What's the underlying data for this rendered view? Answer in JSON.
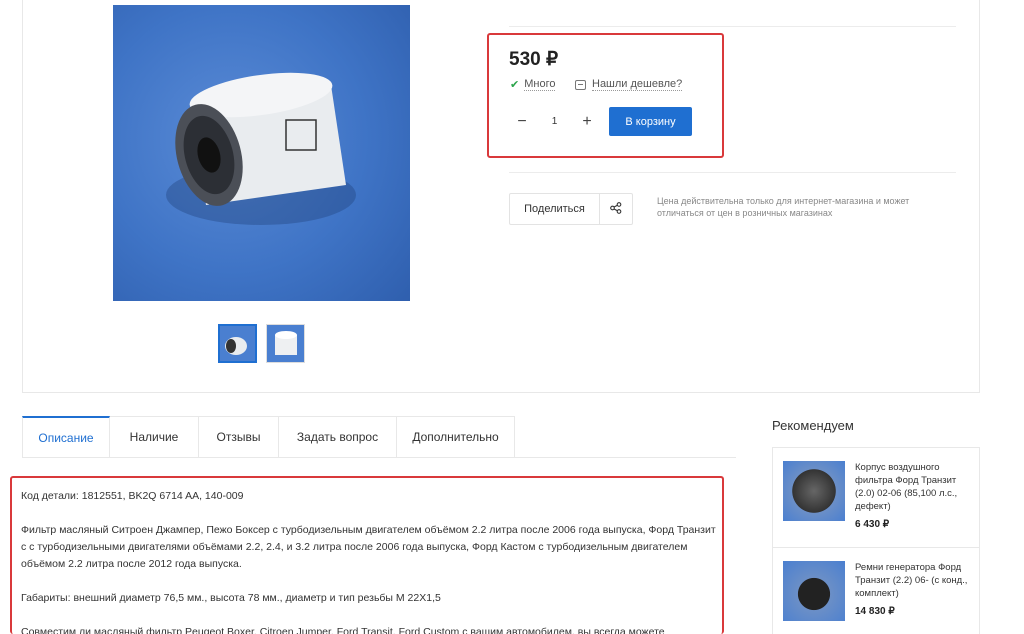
{
  "product": {
    "price": "530 ₽",
    "stock_label": "Много",
    "cheaper_label": "Нашли дешевле?",
    "quantity": "1",
    "cart_button": "В корзину",
    "share_label": "Поделиться",
    "price_note": "Цена действительна только для интернет-магазина и может отличаться от цен в розничных магазинах"
  },
  "tabs": [
    {
      "label": "Описание"
    },
    {
      "label": "Наличие"
    },
    {
      "label": "Отзывы"
    },
    {
      "label": "Задать вопрос"
    },
    {
      "label": "Дополнительно"
    }
  ],
  "description": {
    "p1": "Код детали: 1812551, BK2Q 6714 AA, 140-009",
    "p2": "Фильтр масляный Ситроен Джампер, Пежо Боксер с турбодизельным двигателем объёмом 2.2 литра после 2006 года выпуска, Форд Транзит с с турбодизельными двигателями объёмами 2.2, 2.4, и 3.2 литра после 2006 года выпуска, Форд Кастом с турбодизельным двигателем объёмом 2.2 литра после 2012 года выпуска.",
    "p3": "Габариты: внешний диаметр 76,5 мм., высота 78 мм., диаметр и тип резьбы M 22X1,5",
    "p4": "Совместим ли масляный фильтр Peugeot Boxer, Citroen Jumper, Ford Transit, Ford Custom с вашим автомобилем, вы всегда можете"
  },
  "recommend": {
    "title": "Рекомендуем",
    "items": [
      {
        "name": "Корпус воздушного фильтра Форд Транзит (2.0) 02-06 (85,100 л.с., дефект)",
        "price": "6 430 ₽"
      },
      {
        "name": "Ремни генератора Форд Транзит (2.2) 06- (с конд., комплект)",
        "price": "14 830 ₽"
      }
    ]
  },
  "colors": {
    "accent": "#1f6fd1",
    "highlight": "#d9393b",
    "success": "#2aa44a"
  }
}
